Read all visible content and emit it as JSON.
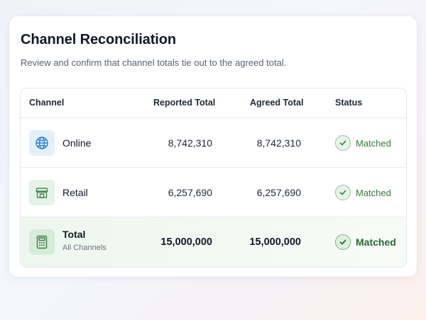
{
  "header": {
    "title": "Channel Reconciliation",
    "subtitle": "Review and confirm that channel totals tie out to the agreed total."
  },
  "table": {
    "columns": {
      "channel": "Channel",
      "reported": "Reported Total",
      "agreed": "Agreed Total",
      "status": "Status"
    },
    "rows": [
      {
        "channel": "Online",
        "icon": "globe-icon",
        "reported": "8,742,310",
        "agreed": "8,742,310",
        "status": "Matched"
      },
      {
        "channel": "Retail",
        "icon": "storefront-icon",
        "reported": "6,257,690",
        "agreed": "6,257,690",
        "status": "Matched"
      }
    ],
    "total": {
      "channel": "Total",
      "sub": "All Channels",
      "icon": "calculator-icon",
      "reported": "15,000,000",
      "agreed": "15,000,000",
      "status": "Matched"
    }
  },
  "colors": {
    "accent_blue": "#2a7fd4",
    "success_green": "#2f7d3c",
    "total_row_bg": "#edf7ee"
  }
}
